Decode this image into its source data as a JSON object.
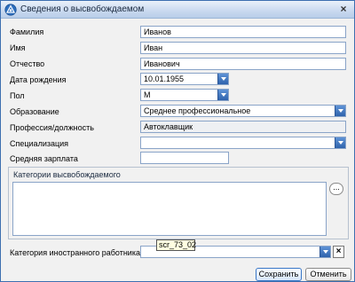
{
  "window": {
    "title": "Сведения о высвобождаемом"
  },
  "form": {
    "last_name": {
      "label": "Фамилия",
      "value": "Иванов"
    },
    "first_name": {
      "label": "Имя",
      "value": "Иван"
    },
    "patronymic": {
      "label": "Отчество",
      "value": "Иванович"
    },
    "birth_date": {
      "label": "Дата рождения",
      "value": "10.01.1955"
    },
    "sex": {
      "label": "Пол",
      "value": "М"
    },
    "education": {
      "label": "Образование",
      "value": "Среднее профессиональное"
    },
    "profession": {
      "label": "Профессия/должность",
      "value": "Автоклавщик"
    },
    "specialization": {
      "label": "Специализация",
      "value": ""
    },
    "salary": {
      "label": "Средняя зарплата",
      "value": ""
    },
    "categories": {
      "label": "Категории высвобождаемого",
      "button": "..."
    },
    "foreign_worker": {
      "label": "Категория иностранного работника",
      "value": ""
    }
  },
  "tooltip": "scr_73_02",
  "buttons": {
    "save": "Сохранить",
    "cancel": "Отменить",
    "clear": "×",
    "close": "×"
  },
  "colors": {
    "titlebar": "#c9d9ef",
    "field_border": "#8aa4c8",
    "dropdown": "#2f63ac"
  }
}
